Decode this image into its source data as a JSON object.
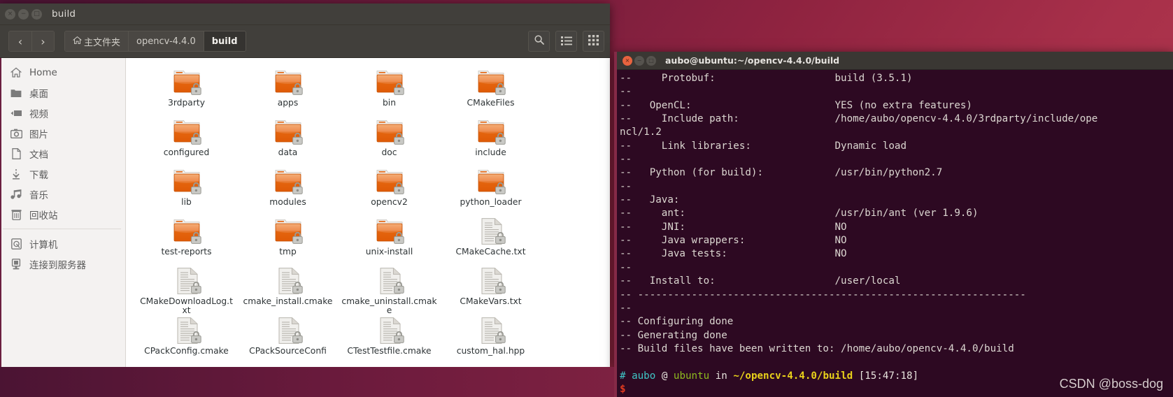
{
  "desktop": {
    "watermark": "CSDN @boss-dog"
  },
  "file_manager": {
    "window_title": "build",
    "window_buttons": {
      "close": "×",
      "minimize": "−",
      "maximize": "□"
    },
    "nav": {
      "back": "‹",
      "forward": "›"
    },
    "breadcrumbs": [
      {
        "label": "主文件夹",
        "icon": "home-icon",
        "active": false
      },
      {
        "label": "opencv-4.4.0",
        "icon": "",
        "active": false
      },
      {
        "label": "build",
        "icon": "",
        "active": true
      }
    ],
    "toolbar_buttons": [
      {
        "name": "search-icon",
        "label": ""
      },
      {
        "name": "list-view-icon",
        "label": ""
      },
      {
        "name": "grid-view-icon",
        "label": ""
      }
    ],
    "sidebar": {
      "items": [
        {
          "label": "Home",
          "icon": "home-icon"
        },
        {
          "label": "桌面",
          "icon": "folder-icon"
        },
        {
          "label": "视频",
          "icon": "video-icon"
        },
        {
          "label": "图片",
          "icon": "camera-icon"
        },
        {
          "label": "文档",
          "icon": "document-icon"
        },
        {
          "label": "下载",
          "icon": "download-icon"
        },
        {
          "label": "音乐",
          "icon": "music-icon"
        },
        {
          "label": "回收站",
          "icon": "trash-icon"
        }
      ],
      "devices": [
        {
          "label": "计算机",
          "icon": "computer-icon"
        },
        {
          "label": "连接到服务器",
          "icon": "server-icon"
        }
      ]
    },
    "files": [
      {
        "name": "3rdparty",
        "type": "folder",
        "locked": true
      },
      {
        "name": "apps",
        "type": "folder",
        "locked": true
      },
      {
        "name": "bin",
        "type": "folder",
        "locked": true
      },
      {
        "name": "CMakeFiles",
        "type": "folder",
        "locked": true
      },
      {
        "name": "configured",
        "type": "folder",
        "locked": true
      },
      {
        "name": "data",
        "type": "folder",
        "locked": true
      },
      {
        "name": "doc",
        "type": "folder",
        "locked": true
      },
      {
        "name": "include",
        "type": "folder",
        "locked": true
      },
      {
        "name": "lib",
        "type": "folder",
        "locked": true
      },
      {
        "name": "modules",
        "type": "folder",
        "locked": true
      },
      {
        "name": "opencv2",
        "type": "folder",
        "locked": true
      },
      {
        "name": "python_loader",
        "type": "folder",
        "locked": true
      },
      {
        "name": "test-reports",
        "type": "folder",
        "locked": true
      },
      {
        "name": "tmp",
        "type": "folder",
        "locked": true
      },
      {
        "name": "unix-install",
        "type": "folder",
        "locked": true
      },
      {
        "name": "CMakeCache.txt",
        "type": "document",
        "locked": true
      },
      {
        "name": "CMakeDownloadLog.txt",
        "type": "document",
        "locked": true
      },
      {
        "name": "cmake_install.cmake",
        "type": "document",
        "locked": true
      },
      {
        "name": "cmake_uninstall.cmake",
        "type": "document",
        "locked": true
      },
      {
        "name": "CMakeVars.txt",
        "type": "document",
        "locked": true
      },
      {
        "name": "CPackConfig.cmake",
        "type": "document",
        "locked": true
      },
      {
        "name": "CPackSourceConfi",
        "type": "document",
        "locked": true
      },
      {
        "name": "CTestTestfile.cmake",
        "type": "document",
        "locked": true
      },
      {
        "name": "custom_hal.hpp",
        "type": "document",
        "locked": true
      }
    ]
  },
  "terminal": {
    "window_title": "aubo@ubuntu:~/opencv-4.4.0/build",
    "window_buttons": {
      "close": "×",
      "minimize": "−",
      "maximize": "□"
    },
    "lines": [
      "--     Protobuf:                    build (3.5.1)",
      "--",
      "--   OpenCL:                        YES (no extra features)",
      "--     Include path:                /home/aubo/opencv-4.4.0/3rdparty/include/ope",
      "ncl/1.2",
      "--     Link libraries:              Dynamic load",
      "--",
      "--   Python (for build):            /usr/bin/python2.7",
      "--",
      "--   Java:",
      "--     ant:                         /usr/bin/ant (ver 1.9.6)",
      "--     JNI:                         NO",
      "--     Java wrappers:               NO",
      "--     Java tests:                  NO",
      "--",
      "--   Install to:                    /user/local",
      "-- -----------------------------------------------------------------",
      "--",
      "-- Configuring done",
      "-- Generating done",
      "-- Build files have been written to: /home/aubo/opencv-4.4.0/build",
      ""
    ],
    "prompt": {
      "hash": "#",
      "user": "aubo",
      "at": "@",
      "host": "ubuntu",
      "in": "in",
      "path": "~/opencv-4.4.0/build",
      "time": "[15:47:18]",
      "symbol": "$"
    },
    "colors": {
      "background": "#2d0922",
      "foreground": "#e8e4de",
      "user": "#3fc7c7",
      "host": "#8fbc1f",
      "path": "#e9d11a",
      "symbol": "#e03a1f"
    }
  }
}
